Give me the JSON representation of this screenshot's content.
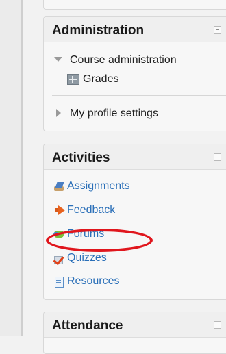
{
  "administration": {
    "title": "Administration",
    "course_admin": "Course administration",
    "grades": "Grades",
    "profile_settings": "My profile settings"
  },
  "activities": {
    "title": "Activities",
    "items": [
      "Assignments",
      "Feedback",
      "Forums",
      "Quizzes",
      "Resources"
    ]
  },
  "attendance": {
    "title": "Attendance"
  },
  "colors": {
    "link": "#2a6fb8",
    "highlight": "#e0161d"
  }
}
